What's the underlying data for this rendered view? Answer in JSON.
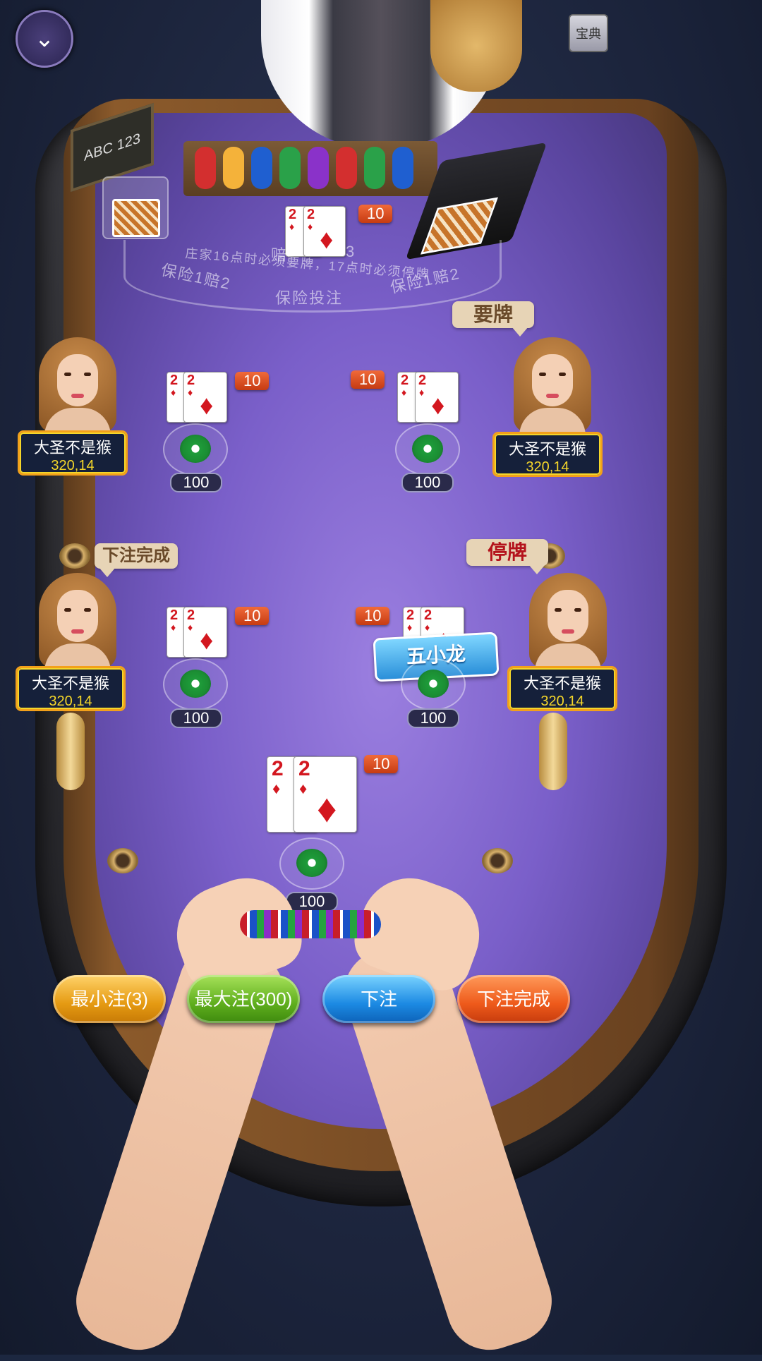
{
  "header": {
    "collapse_icon": "chevron-down-icon",
    "handbook_label": "宝典",
    "table_sign": "ABC 123"
  },
  "table": {
    "payout_partial_left": "赔",
    "payout_partial_right": "3",
    "rule_text": "庄家16点时必须要牌，17点时必须停牌",
    "insurance_left": "保险1赔2",
    "insurance_center": "保险投注",
    "insurance_right": "保险1赔2"
  },
  "dealer": {
    "cards": [
      {
        "rank": "2",
        "suit": "♦"
      },
      {
        "rank": "2",
        "suit": "♦"
      }
    ],
    "points": "10"
  },
  "seats": [
    {
      "id": "left-top",
      "name": "大圣不是猴",
      "score": "320,14",
      "points": "10",
      "bet": "100",
      "bubble": "",
      "chip_label": "♠"
    },
    {
      "id": "right-top",
      "name": "大圣不是猴",
      "score": "320,14",
      "points": "10",
      "bet": "100",
      "bubble": "要牌",
      "chip_label": "♠"
    },
    {
      "id": "left-bottom",
      "name": "大圣不是猴",
      "score": "320,14",
      "points": "10",
      "bet": "100",
      "bubble": "下注完成",
      "chip_label": "♠"
    },
    {
      "id": "right-bottom",
      "name": "大圣不是猴",
      "score": "320,14",
      "points": "10",
      "bet": "100",
      "bubble": "停牌",
      "chip_label": "♠",
      "banner": "五小龙"
    }
  ],
  "self_seat": {
    "points": "10",
    "bet": "100",
    "chip_label": "♠"
  },
  "actions": {
    "min_bet": "最小注(3)",
    "max_bet": "最大注(300)",
    "bet": "下注",
    "bet_done": "下注完成"
  },
  "colors": {
    "felt": "#7a5fc9",
    "points_badge": "#e8531f",
    "nameplate_border": "#f2a01b",
    "score_text": "#f4d62a"
  }
}
